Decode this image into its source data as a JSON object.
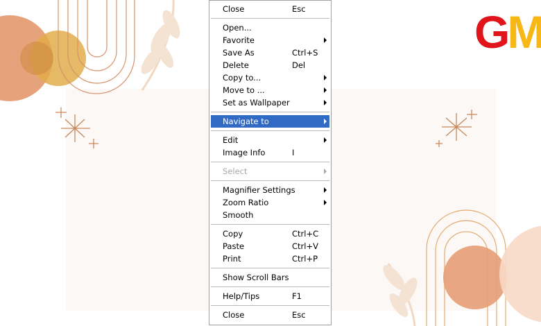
{
  "brand": {
    "logo_letters": [
      "G",
      "M"
    ],
    "colors": {
      "g": "#e1141c",
      "m": "#f7b716"
    }
  },
  "menu": {
    "groups": [
      [
        {
          "label": "Close",
          "shortcut": "Esc"
        }
      ],
      [
        {
          "label": "Open...",
          "shortcut": ""
        },
        {
          "label": "Favorite",
          "shortcut": "",
          "submenu": true
        },
        {
          "label": "Save As",
          "shortcut": "Ctrl+S"
        },
        {
          "label": "Delete",
          "shortcut": "Del"
        },
        {
          "label": "Copy to...",
          "shortcut": "",
          "submenu": true
        },
        {
          "label": "Move to ...",
          "shortcut": "",
          "submenu": true
        },
        {
          "label": "Set as Wallpaper",
          "shortcut": "",
          "submenu": true
        }
      ],
      [
        {
          "label": "Navigate to",
          "shortcut": "",
          "submenu": true,
          "highlighted": true
        }
      ],
      [
        {
          "label": "Edit",
          "shortcut": "",
          "submenu": true
        },
        {
          "label": "Image Info",
          "shortcut": "I"
        }
      ],
      [
        {
          "label": "Select",
          "shortcut": "",
          "submenu": true,
          "disabled": true
        }
      ],
      [
        {
          "label": "Magnifier Settings",
          "shortcut": "",
          "submenu": true
        },
        {
          "label": "Zoom Ratio",
          "shortcut": "",
          "submenu": true
        },
        {
          "label": "Smooth",
          "shortcut": ""
        }
      ],
      [
        {
          "label": "Copy",
          "shortcut": "Ctrl+C"
        },
        {
          "label": "Paste",
          "shortcut": "Ctrl+V"
        },
        {
          "label": "Print",
          "shortcut": "Ctrl+P"
        }
      ],
      [
        {
          "label": "Show Scroll Bars",
          "shortcut": ""
        }
      ],
      [
        {
          "label": "Help/Tips",
          "shortcut": "F1"
        }
      ],
      [
        {
          "label": "Close",
          "shortcut": "Esc"
        }
      ]
    ],
    "colors": {
      "highlight": "#316ac5",
      "disabled_text": "#a8a8a8"
    }
  },
  "icons": [
    "sparkle-icon",
    "leaf-icon",
    "arch-icon",
    "submenu-arrow-icon"
  ]
}
